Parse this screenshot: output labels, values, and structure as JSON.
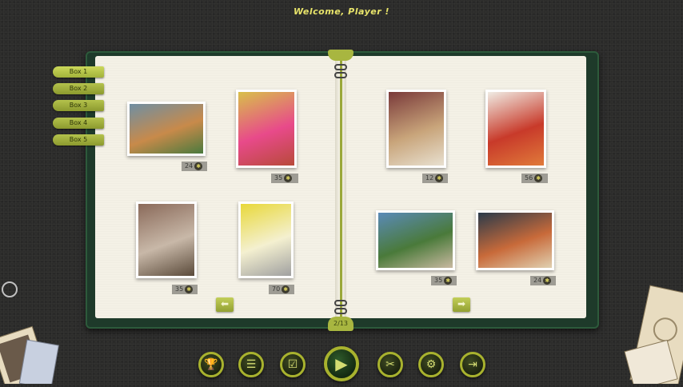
{
  "header": {
    "welcome": "Welcome, Player !"
  },
  "boxes": [
    {
      "label": "Box 1",
      "active": true
    },
    {
      "label": "Box 2",
      "active": false
    },
    {
      "label": "Box 3",
      "active": false
    },
    {
      "label": "Box 4",
      "active": false
    },
    {
      "label": "Box 5",
      "active": false
    }
  ],
  "puzzles": [
    {
      "count": "24",
      "colors": [
        "#6f8fa3",
        "#c88a4a",
        "#4a7a3e"
      ]
    },
    {
      "count": "35",
      "colors": [
        "#d8c04a",
        "#e84a8a",
        "#b84a3a"
      ]
    },
    {
      "count": "35",
      "colors": [
        "#8a6a5a",
        "#c8b8a8",
        "#5a4a3a"
      ]
    },
    {
      "count": "70",
      "colors": [
        "#e8d83a",
        "#f4f0d0",
        "#a0a0a0"
      ]
    },
    {
      "count": "12",
      "colors": [
        "#7a3a3a",
        "#c8a47a",
        "#e8e0d0"
      ]
    },
    {
      "count": "56",
      "colors": [
        "#f0ece4",
        "#c83a2a",
        "#e07a3a"
      ]
    },
    {
      "count": "35",
      "colors": [
        "#5a8ab8",
        "#4a7a3a",
        "#c8b8a0"
      ]
    },
    {
      "count": "24",
      "colors": [
        "#2a3a4a",
        "#c86a3a",
        "#e0d0b0"
      ]
    }
  ],
  "pagination": {
    "label": "2/13",
    "prev": "⬅",
    "next": "➡"
  },
  "toolbar": {
    "trophy": "🏆",
    "menu": "☰",
    "check": "☑",
    "play": "▶",
    "scissors": "✂",
    "settings": "⚙",
    "exit": "⇥"
  },
  "accent_color": "#a8b22e"
}
